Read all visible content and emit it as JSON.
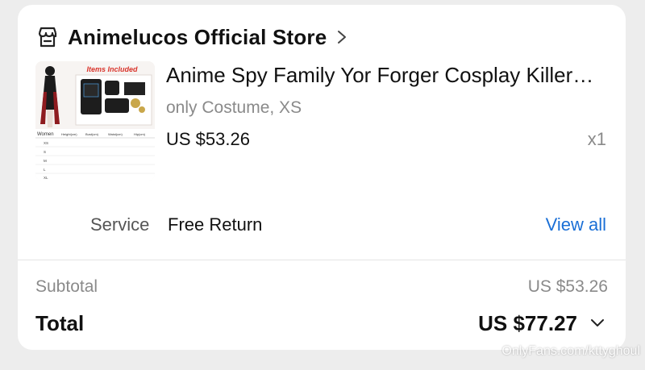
{
  "store": {
    "name": "Animelucos Official Store",
    "store_icon": "storefront-icon",
    "chevron_icon": "chevron-right-icon"
  },
  "product": {
    "title": "Anime Spy Family Yor Forger Cosplay Killer…",
    "variant": "only Costume, XS",
    "price": "US $53.26",
    "quantity": "x1",
    "thumbnail": {
      "badge": "Items Included",
      "table_header": [
        "Women",
        "Height(cm)",
        "Bust(cm)",
        "Waist(cm)",
        "Hip(cm)"
      ],
      "sizes": [
        "XS",
        "S",
        "M",
        "L",
        "XL"
      ]
    }
  },
  "service": {
    "label": "Service",
    "value": "Free Return",
    "link": "View all"
  },
  "summary": {
    "subtotal_label": "Subtotal",
    "subtotal_value": "US $53.26",
    "total_label": "Total",
    "total_value": "US $77.27",
    "expand_icon": "chevron-down-icon"
  },
  "watermark": "OnlyFans.com/kttyghoul",
  "colors": {
    "link": "#1a6fd6",
    "muted": "#8a8a8a",
    "badge_red": "#d9342b"
  }
}
